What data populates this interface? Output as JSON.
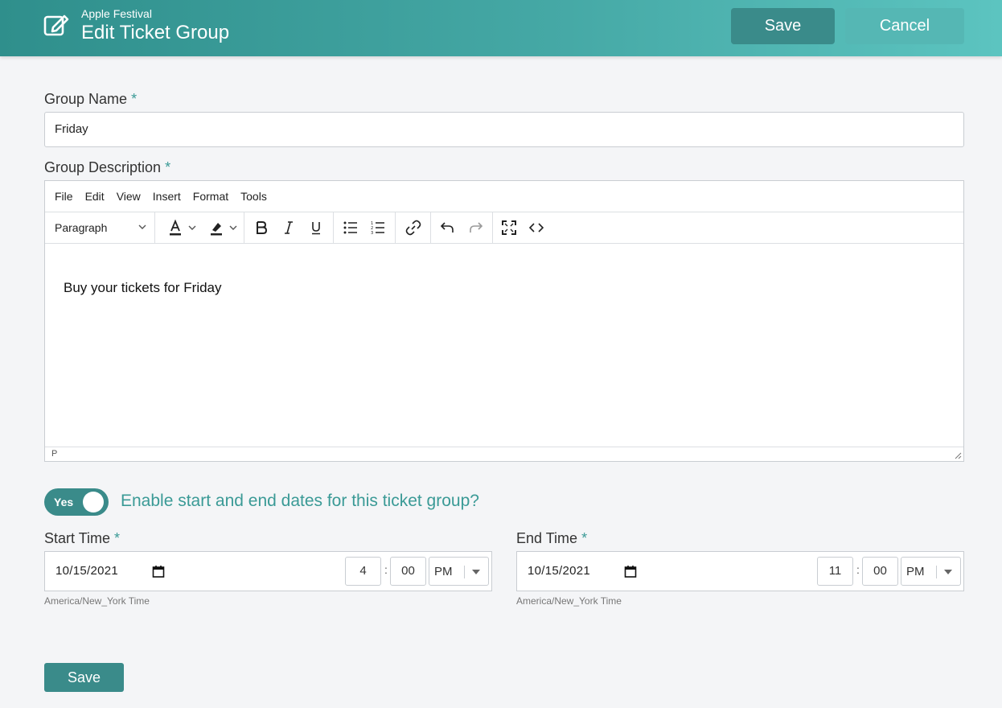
{
  "header": {
    "subtitle": "Apple Festival",
    "title": "Edit Ticket Group",
    "save_label": "Save",
    "cancel_label": "Cancel"
  },
  "form": {
    "group_name_label": "Group Name",
    "group_name_value": "Friday",
    "group_description_label": "Group Description",
    "required_marker": "*"
  },
  "editor": {
    "menu": [
      "File",
      "Edit",
      "View",
      "Insert",
      "Format",
      "Tools"
    ],
    "block_format": "Paragraph",
    "content": "Buy your tickets for Friday",
    "status_path": "P"
  },
  "dates_toggle": {
    "label": "Yes",
    "question": "Enable start and end dates for this ticket group?"
  },
  "start_time": {
    "label": "Start Time",
    "date": "10/15/2021",
    "hour": "4",
    "minute": "00",
    "ampm": "PM",
    "timezone": "America/New_York Time"
  },
  "end_time": {
    "label": "End Time",
    "date": "10/15/2021",
    "hour": "11",
    "minute": "00",
    "ampm": "PM",
    "timezone": "America/New_York Time"
  },
  "footer": {
    "save_label": "Save"
  },
  "colors": {
    "accent": "#3a8b8a",
    "accent_text": "#3a9a96"
  }
}
